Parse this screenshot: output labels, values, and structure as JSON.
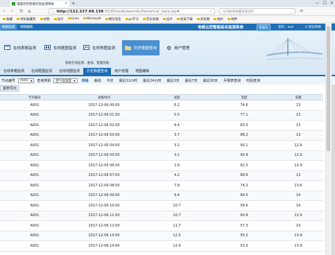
{
  "browser": {
    "tab_title": "电缆云控智能综合监测系统",
    "close": "✕",
    "new_tab": "+",
    "window_controls": [
      "—",
      "☐",
      "✕"
    ],
    "nav_back": "‹",
    "nav_forward": "›",
    "nav_reload": "↻",
    "nav_home": "⌂",
    "url_host": "http://122.227.69.138",
    "url_path": ":5535/node/wemdu/historical_data.jsp#",
    "search_placeholder": "台湾輸電線纜發展現狀",
    "bookmarks": [
      "收藏",
      "手机收藏夹",
      "谷歌",
      "设计",
      "Links",
      "Microsoft",
      "网页淘宝",
      "ps学习",
      "京东商城",
      "设计",
      "优美下载",
      "资讯网",
      "图片",
      "邮件"
    ]
  },
  "app": {
    "top_tabs": [
      "数据监测",
      "地图编辑"
    ],
    "system_title": "电缆云控智能综合监测系统",
    "admin_badge": "管理员",
    "user_greeting": "您好，wyz",
    "logout": "退出系统",
    "menu": [
      "在线表格监测",
      "在线框图监测",
      "在线地图监测",
      "历史数据查询",
      "用户管理"
    ],
    "menu_active_index": 3,
    "description": "系统在线监测、查询、管理功能",
    "subnav": [
      "在线表格监测",
      "在线框图监测",
      "在线地图监测",
      "历史数据查询",
      "用户管理",
      "地图编辑"
    ],
    "subnav_active_index": 3
  },
  "filter": {
    "node_label": "节点编号",
    "node_value": "A001",
    "type_label": "查询类别",
    "type_value": "空气温湿度",
    "view_tabs": [
      "表格",
      "曲线"
    ],
    "view_active_index": 0,
    "time_tabs": [
      "今天",
      "最近12小时",
      "最近24小时",
      "最近3天",
      "最近7天",
      "最近30天",
      "月报表查询",
      "时段查询"
    ]
  },
  "export_button": "报表导出",
  "table": {
    "headers": [
      "节点编号",
      "采集时间",
      "温度",
      "湿度",
      "电量"
    ],
    "rows": [
      [
        "A001",
        "2017-12-06 00:00",
        "6.2",
        "74.6",
        "13"
      ],
      [
        "A001",
        "2017-12-06 01:00",
        "5.5",
        "77.1",
        "13"
      ],
      [
        "A001",
        "2017-12-06 02:00",
        "4.4",
        "83.3",
        "13"
      ],
      [
        "A001",
        "2017-12-06 03:00",
        "3.7",
        "88.2",
        "13"
      ],
      [
        "A001",
        "2017-12-06 04:00",
        "3.2",
        "90.1",
        "12.9"
      ],
      [
        "A001",
        "2017-12-06 05:00",
        "3.1",
        "90.9",
        "12.9"
      ],
      [
        "A001",
        "2017-12-06 06:00",
        "2.6",
        "92.5",
        "12.9"
      ],
      [
        "A001",
        "2017-12-06 07:00",
        "4.2",
        "88.6",
        "13"
      ],
      [
        "A001",
        "2017-12-06 08:00",
        "7.8",
        "74.2",
        "13.6"
      ],
      [
        "A001",
        "2017-12-06 09:00",
        "9.4",
        "66.5",
        "14"
      ],
      [
        "A001",
        "2017-12-06 10:00",
        "10.7",
        "58.6",
        "14"
      ],
      [
        "A001",
        "2017-12-06 11:00",
        "10.7",
        "60.8",
        "12.9"
      ],
      [
        "A001",
        "2017-12-06 12:00",
        "11.7",
        "57.3",
        "14"
      ],
      [
        "A001",
        "2017-12-06 13:00",
        "12.5",
        "55.2",
        "13.9"
      ],
      [
        "A001",
        "2017-12-06 14:00",
        "12.9",
        "53.3",
        "13.9"
      ]
    ]
  }
}
